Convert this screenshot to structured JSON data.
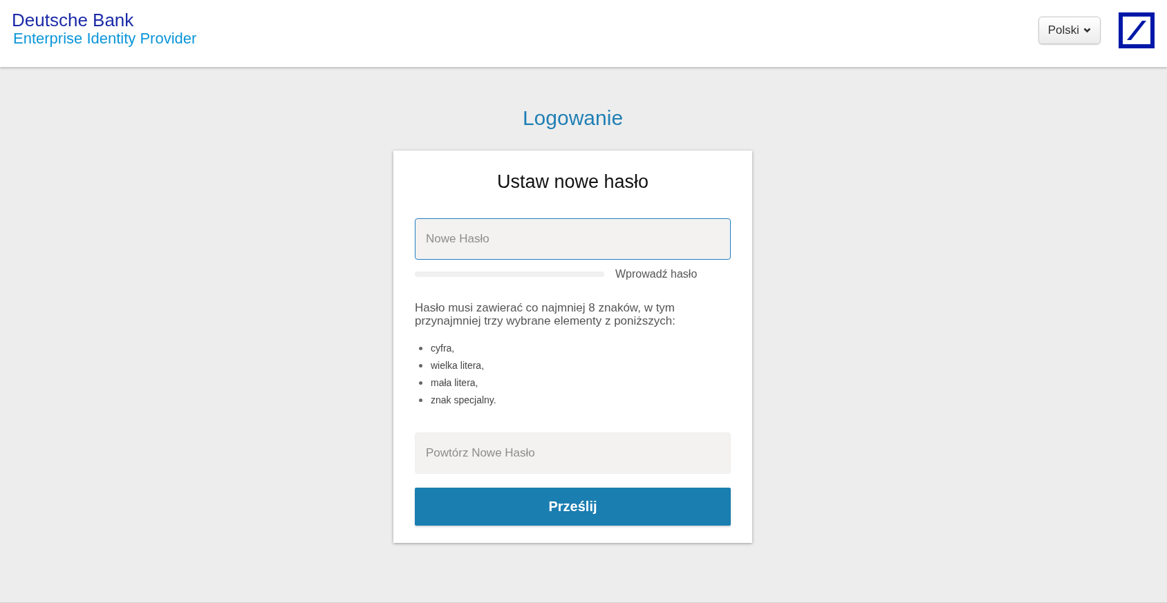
{
  "header": {
    "brand": "Deutsche Bank",
    "subtitle": "Enterprise Identity Provider",
    "language_button": "Polski"
  },
  "page_title": "Logowanie",
  "card": {
    "title": "Ustaw nowe hasło",
    "new_password": {
      "placeholder": "Nowe Hasło",
      "focused": true
    },
    "strength": {
      "label": "Wprowadź hasło"
    },
    "rules_intro": "Hasło musi zawierać co najmniej 8 znaków, w tym przynajmniej trzy wybrane elementy z poniższych:",
    "rules": [
      "cyfra,",
      "wielka litera,",
      "mała litera,",
      "znak specjalny."
    ],
    "repeat_password": {
      "placeholder": "Powtórz Nowe Hasło",
      "focused": false
    },
    "submit": "Prześlij"
  }
}
